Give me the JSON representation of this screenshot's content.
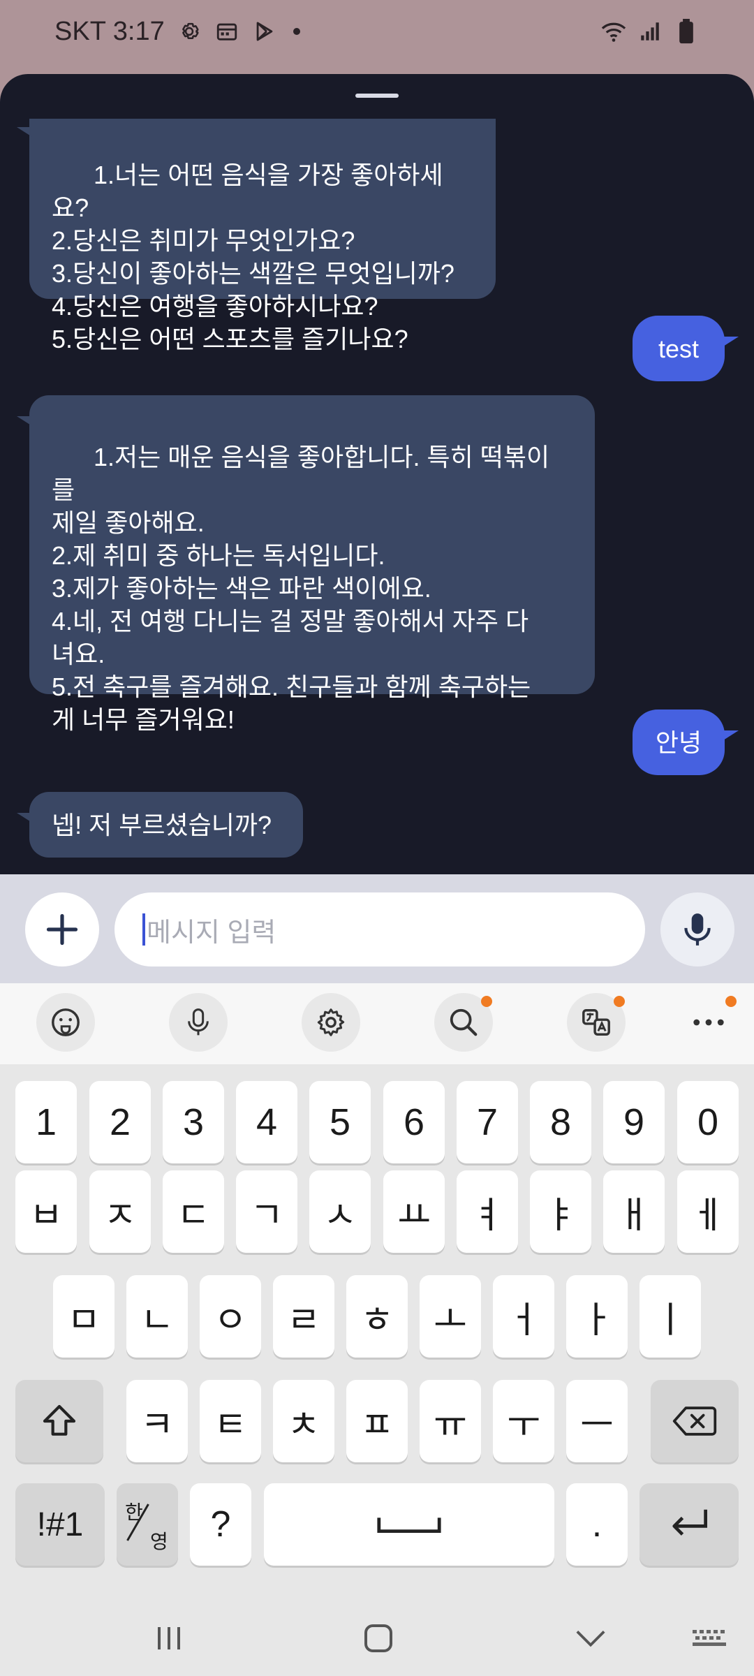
{
  "status_bar": {
    "carrier_time": "SKT 3:17"
  },
  "colors": {
    "sheet_bg": "#181a28",
    "bot_bubble": "#3a4764",
    "user_bubble": "#4661e0",
    "badge": "#f07b22",
    "status_bg": "#ae9498"
  },
  "chat": {
    "messages": [
      {
        "role": "bot",
        "text": "1.너는 어떤 음식을 가장 좋아하세요?\n2.당신은 취미가 무엇인가요?\n3.당신이 좋아하는 색깔은 무엇입니까?\n4.당신은 여행을 좋아하시나요?\n5.당신은 어떤 스포츠를 즐기나요?"
      },
      {
        "role": "user",
        "text": "test"
      },
      {
        "role": "bot",
        "text": "1.저는 매운 음식을 좋아합니다. 특히 떡볶이를\n제일 좋아해요.\n2.제 취미 중 하나는 독서입니다.\n3.제가 좋아하는 색은 파란 색이에요.\n4.네, 전 여행 다니는 걸 정말 좋아해서 자주 다\n녀요.\n5.전 축구를 즐겨해요. 친구들과 함께 축구하는\n게 너무 즐거워요!"
      },
      {
        "role": "user",
        "text": "안녕"
      },
      {
        "role": "bot",
        "text": "넵! 저 부르셨습니까?"
      }
    ]
  },
  "composer": {
    "placeholder": "메시지 입력"
  },
  "keyboard": {
    "toolbar": [
      {
        "icon": "emoji-icon",
        "badge": false
      },
      {
        "icon": "voice-input-icon",
        "badge": false
      },
      {
        "icon": "settings-icon",
        "badge": false
      },
      {
        "icon": "search-icon",
        "badge": true
      },
      {
        "icon": "translate-icon",
        "badge": true
      },
      {
        "icon": "more-icon",
        "badge": true
      }
    ],
    "row_numbers": [
      "1",
      "2",
      "3",
      "4",
      "5",
      "6",
      "7",
      "8",
      "9",
      "0"
    ],
    "row_1": [
      "ㅂ",
      "ㅈ",
      "ㄷ",
      "ㄱ",
      "ㅅ",
      "ㅛ",
      "ㅕ",
      "ㅑ",
      "ㅐ",
      "ㅔ"
    ],
    "row_2": [
      "ㅁ",
      "ㄴ",
      "ㅇ",
      "ㄹ",
      "ㅎ",
      "ㅗ",
      "ㅓ",
      "ㅏ",
      "ㅣ"
    ],
    "row_3": [
      "ㅋ",
      "ㅌ",
      "ㅊ",
      "ㅍ",
      "ㅠ",
      "ㅜ",
      "ㅡ"
    ],
    "symbols_key": "!#1",
    "lang_key_top": "한",
    "lang_key_bottom": "영",
    "question_key": "?",
    "period_key": "."
  }
}
